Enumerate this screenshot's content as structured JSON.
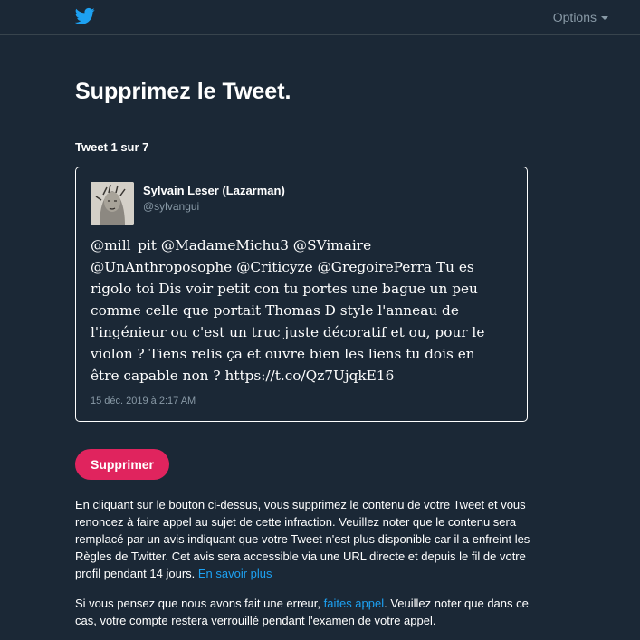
{
  "header": {
    "logo": "twitter-bird-icon",
    "options_label": "Options"
  },
  "page": {
    "title": "Supprimez le Tweet.",
    "counter": "Tweet 1 sur 7"
  },
  "tweet": {
    "author_name": "Sylvain Leser (Lazarman)",
    "author_handle": "@sylvangui",
    "text": "@mill_pit @MadameMichu3 @SVimaire @UnAnthroposophe @Criticyze @GregoirePerra Tu es rigolo toi Dis voir petit con tu portes une bague un peu comme celle que portait Thomas D style l'anneau de l'ingénieur ou c'est un truc juste décoratif et ou, pour le violon ? Tiens relis ça et ouvre bien les liens tu dois en être capable non ? https://t.co/Qz7UjqkE16",
    "date": "15 déc. 2019 à 2:17 AM"
  },
  "actions": {
    "delete_label": "Supprimer"
  },
  "info": {
    "paragraph1": "En cliquant sur le bouton ci-dessus, vous supprimez le contenu de votre Tweet et vous renoncez à faire appel au sujet de cette infraction. Veuillez noter que le contenu sera remplacé par un avis indiquant que votre Tweet n'est plus disponible car il a enfreint les Règles de Twitter. Cet avis sera accessible via une URL directe et depuis le fil de votre profil pendant 14 jours. ",
    "learn_more_link": "En savoir plus",
    "paragraph2_before": "Si vous pensez que nous avons fait une erreur, ",
    "appeal_link": "faites appel",
    "paragraph2_after": ". Veuillez noter que dans ce cas, votre compte restera verrouillé pendant l'examen de votre appel."
  },
  "colors": {
    "background": "#1b2836",
    "accent": "#1da1f2",
    "delete_button": "#e0245e",
    "muted_text": "#8899a6"
  }
}
